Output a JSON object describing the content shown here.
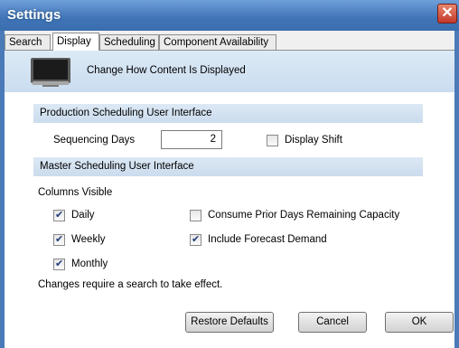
{
  "window": {
    "title": "Settings"
  },
  "tabs": [
    "Search",
    "Display",
    "Scheduling",
    "Component Availability"
  ],
  "header": {
    "text": "Change How Content Is Displayed",
    "icon": "monitor-icon"
  },
  "production": {
    "section_title": "Production Scheduling User Interface",
    "sequencing_days_label": "Sequencing Days",
    "sequencing_days_value": "2",
    "display_shift_label": "Display Shift",
    "display_shift_checked": false
  },
  "master": {
    "section_title": "Master Scheduling User Interface",
    "columns_visible_label": "Columns Visible",
    "daily_label": "Daily",
    "daily_checked": true,
    "weekly_label": "Weekly",
    "weekly_checked": true,
    "monthly_label": "Monthly",
    "monthly_checked": true,
    "consume_label": "Consume Prior Days Remaining Capacity",
    "consume_checked": false,
    "forecast_label": "Include Forecast Demand",
    "forecast_checked": true
  },
  "note": "Changes require a search to take effect.",
  "buttons": {
    "restore": "Restore Defaults",
    "cancel": "Cancel",
    "ok": "OK"
  }
}
